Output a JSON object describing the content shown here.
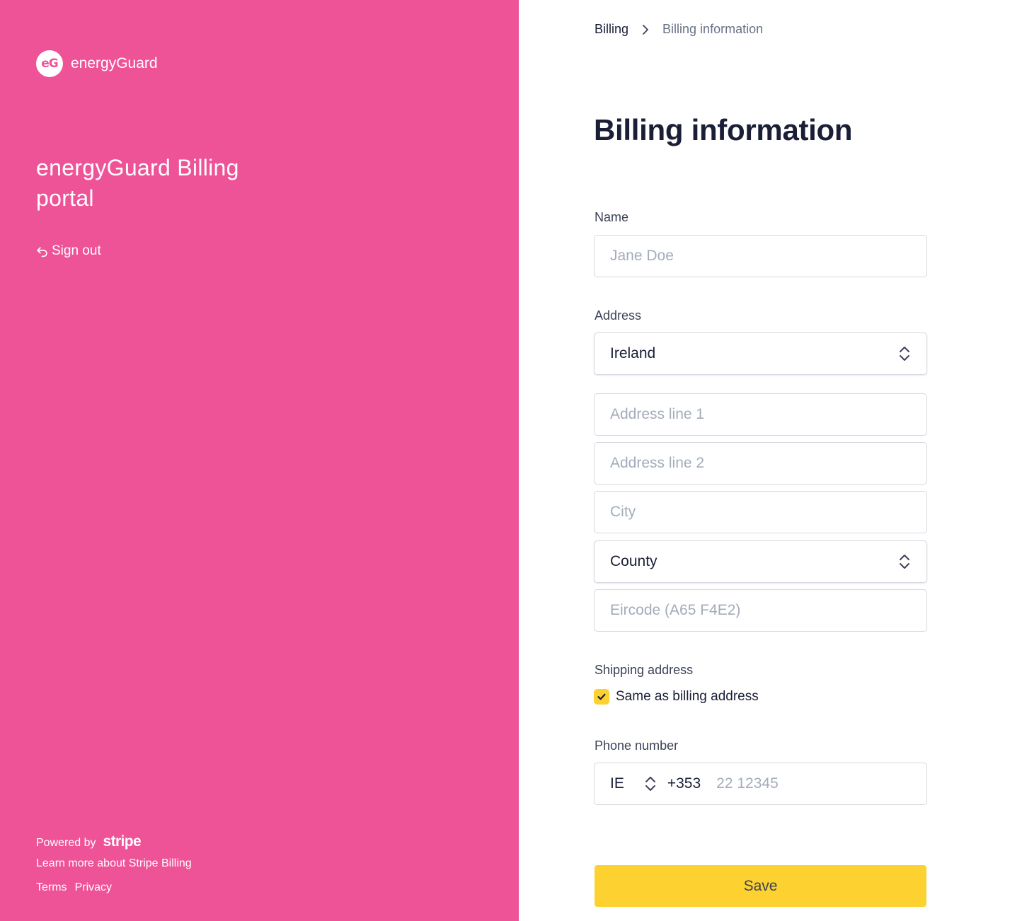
{
  "brand": {
    "logo_text": "eG",
    "name": "energyGuard"
  },
  "sidebar": {
    "portal_title": "energyGuard Billing portal",
    "sign_out": "Sign out",
    "powered_by": "Powered by",
    "stripe_logo": "stripe",
    "learn_more": "Learn more about Stripe Billing",
    "terms": "Terms",
    "privacy": "Privacy"
  },
  "breadcrumb": {
    "parent": "Billing",
    "current": "Billing information"
  },
  "page_title": "Billing information",
  "form": {
    "name_label": "Name",
    "name_placeholder": "Jane Doe",
    "address_label": "Address",
    "country_value": "Ireland",
    "address_line1_placeholder": "Address line 1",
    "address_line2_placeholder": "Address line 2",
    "city_placeholder": "City",
    "county_value": "County",
    "eircode_placeholder": "Eircode (A65 F4E2)",
    "shipping_label": "Shipping address",
    "same_as_billing": "Same as billing address",
    "same_as_billing_checked": true,
    "phone_label": "Phone number",
    "phone_country": "IE",
    "phone_dial_code": "+353",
    "phone_placeholder": "22 12345",
    "save_label": "Save"
  },
  "colors": {
    "sidebar_bg": "#ee5398",
    "accent": "#fcd130",
    "text_primary": "#1a1f36",
    "placeholder": "#a3acb9",
    "border": "#d5d8de"
  },
  "icons": {
    "sign_out": "return-arrow-icon",
    "breadcrumb_sep": "chevron-right-icon",
    "select": "chevron-up-down-icon",
    "checkbox": "checkmark-icon"
  }
}
